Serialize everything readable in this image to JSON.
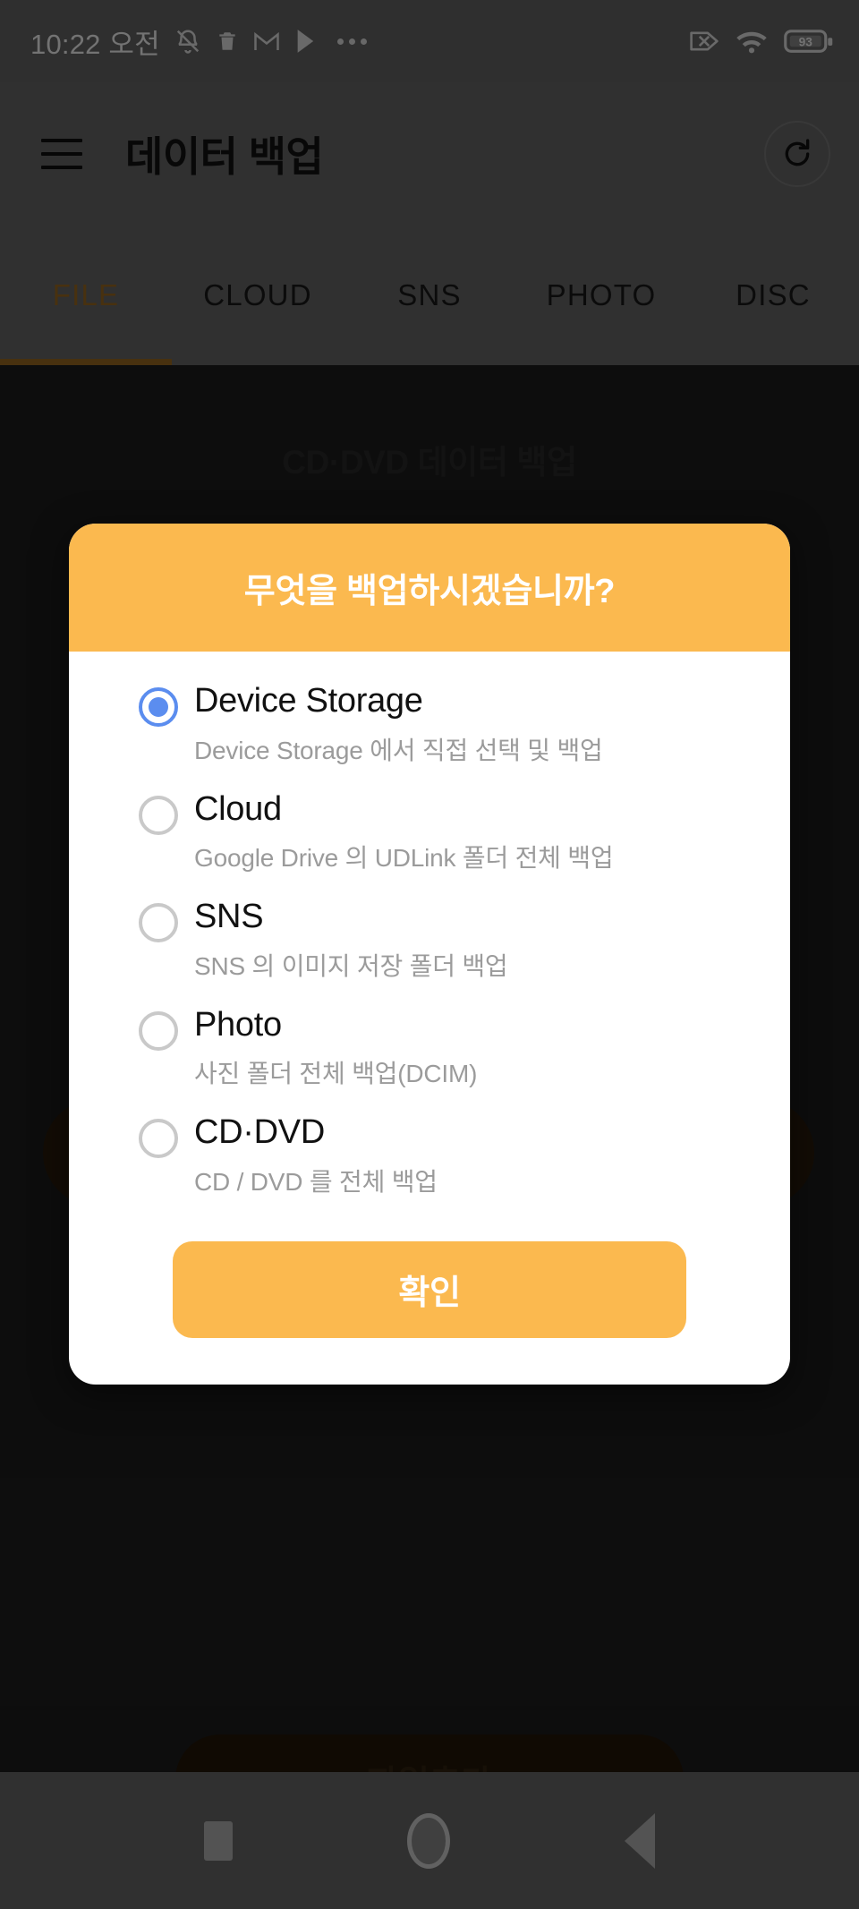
{
  "statusbar": {
    "time": "10:22 오전",
    "left_icons": [
      "bell-mute-icon",
      "trash-icon",
      "gmail-icon",
      "play-store-icon",
      "overflow-dots-icon"
    ],
    "right_icons": [
      "no-sim-icon",
      "wifi-icon"
    ],
    "battery_level": "93"
  },
  "appbar": {
    "menu_icon": "hamburger-menu-icon",
    "title": "데이터 백업",
    "refresh_icon": "refresh-icon"
  },
  "tabs": [
    {
      "label": "FILE",
      "active": true
    },
    {
      "label": "CLOUD",
      "active": false
    },
    {
      "label": "SNS",
      "active": false
    },
    {
      "label": "PHOTO",
      "active": false
    },
    {
      "label": "DISC",
      "active": false
    }
  ],
  "content": {
    "heading": "CD·DVD  데이터 백업",
    "add_file_button": "파일추가"
  },
  "dialog": {
    "title": "무엇을 백업하시겠습니까?",
    "options": [
      {
        "title": "Device Storage",
        "subtitle": "Device Storage 에서 직접 선택 및 백업",
        "selected": true
      },
      {
        "title": "Cloud",
        "subtitle": "Google Drive 의 UDLink 폴더 전체 백업",
        "selected": false
      },
      {
        "title": "SNS",
        "subtitle": "SNS 의 이미지 저장 폴더 백업",
        "selected": false
      },
      {
        "title": "Photo",
        "subtitle": "사진 폴더 전체 백업(DCIM)",
        "selected": false
      },
      {
        "title": "CD·DVD",
        "subtitle": "CD / DVD 를 전체 백업",
        "selected": false
      }
    ],
    "confirm_label": "확인"
  },
  "navbar": {
    "recents": "recents-square-icon",
    "home": "home-circle-icon",
    "back": "back-triangle-icon"
  },
  "colors": {
    "accent_orange": "#fbb94f",
    "tab_active": "#a06d22",
    "radio_blue": "#5b8def",
    "status_gray": "#686868",
    "content_dark": "#1e1e1e"
  }
}
